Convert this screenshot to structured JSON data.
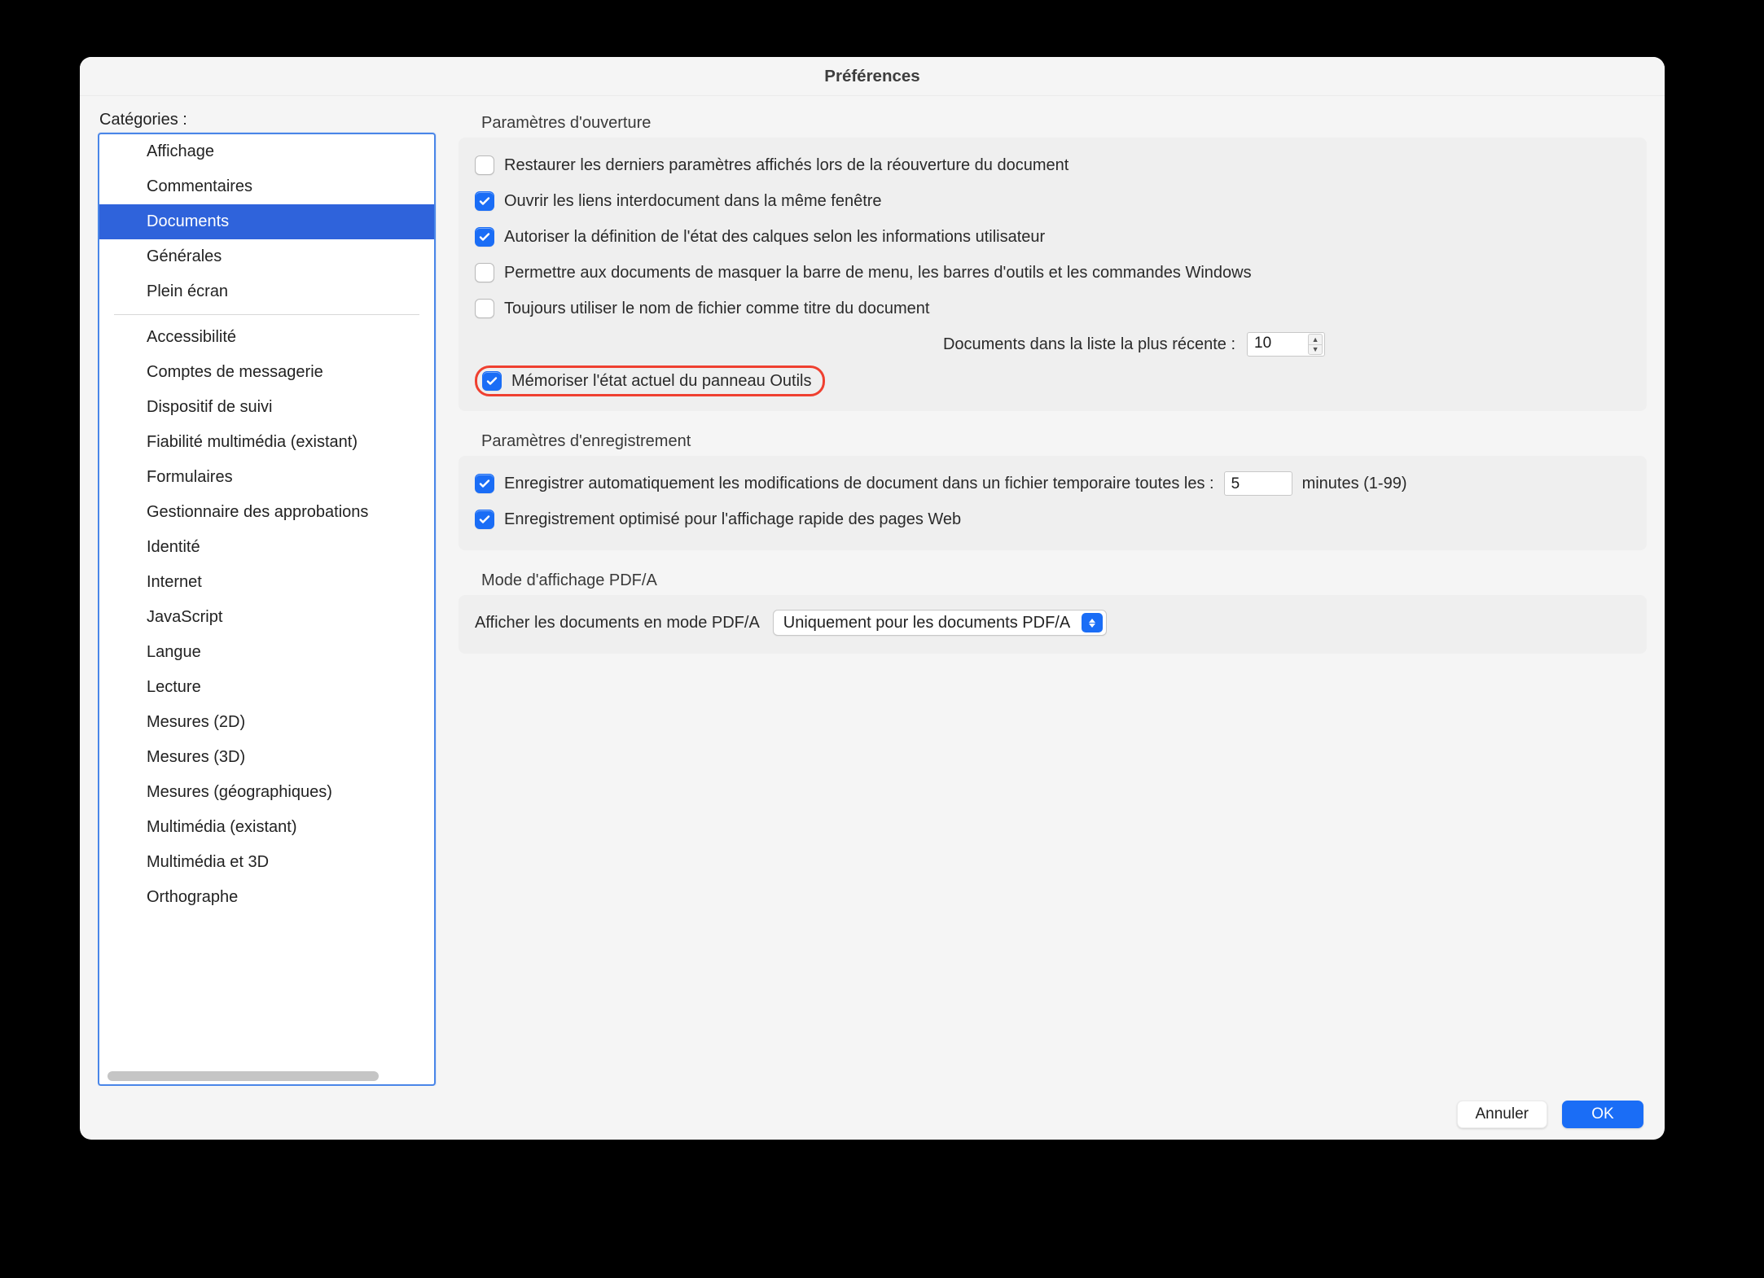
{
  "window": {
    "title": "Préférences"
  },
  "sidebar": {
    "label": "Catégories :",
    "group1": [
      "Affichage",
      "Commentaires",
      "Documents",
      "Générales",
      "Plein écran"
    ],
    "selected_index": 2,
    "group2": [
      "Accessibilité",
      "Comptes de messagerie",
      "Dispositif de suivi",
      "Fiabilité multimédia (existant)",
      "Formulaires",
      "Gestionnaire des approbations",
      "Identité",
      "Internet",
      "JavaScript",
      "Langue",
      "Lecture",
      "Mesures (2D)",
      "Mesures (3D)",
      "Mesures (géographiques)",
      "Multimédia (existant)",
      "Multimédia et 3D",
      "Orthographe"
    ]
  },
  "sections": {
    "open": {
      "title": "Paramètres d'ouverture",
      "c1": {
        "checked": false,
        "label": "Restaurer les derniers paramètres affichés lors de la réouverture du document"
      },
      "c2": {
        "checked": true,
        "label": "Ouvrir les liens interdocument dans la même fenêtre"
      },
      "c3": {
        "checked": true,
        "label": "Autoriser la définition de l'état des calques selon les informations utilisateur"
      },
      "c4": {
        "checked": false,
        "label": "Permettre aux documents de masquer la barre de menu, les barres d'outils et les commandes Windows"
      },
      "c5": {
        "checked": false,
        "label": "Toujours utiliser le nom de fichier comme titre du document"
      },
      "recent_label": "Documents dans la liste la plus récente :",
      "recent_value": "10",
      "c6": {
        "checked": true,
        "label": "Mémoriser l'état actuel du panneau Outils"
      }
    },
    "save": {
      "title": "Paramètres d'enregistrement",
      "auto": {
        "checked": true,
        "label_before": "Enregistrer automatiquement les modifications de document dans un fichier temporaire toutes les :",
        "value": "5",
        "label_after": "minutes (1-99)"
      },
      "fastweb": {
        "checked": true,
        "label": "Enregistrement optimisé pour l'affichage rapide des pages Web"
      }
    },
    "pdfa": {
      "title": "Mode d'affichage PDF/A",
      "label": "Afficher les documents en mode PDF/A",
      "selected": "Uniquement pour les documents PDF/A"
    }
  },
  "footer": {
    "cancel": "Annuler",
    "ok": "OK"
  }
}
